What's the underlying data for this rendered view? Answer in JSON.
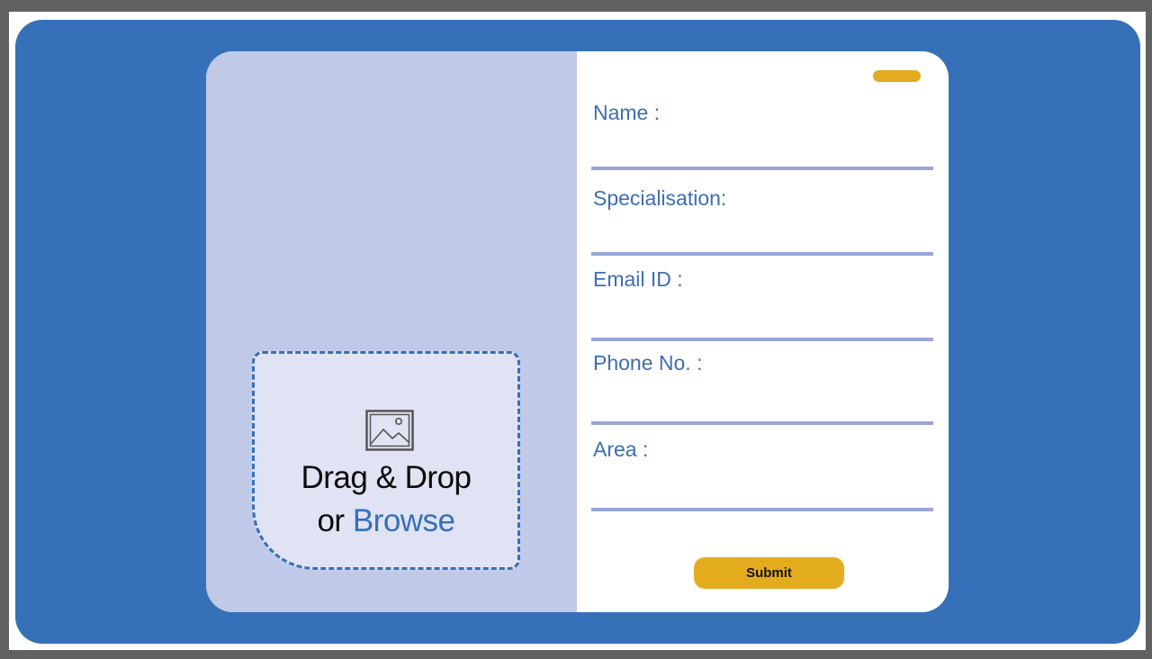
{
  "upload": {
    "icon": "image-icon",
    "line1": "Drag & Drop",
    "line2_prefix": "or ",
    "browse_label": "Browse"
  },
  "form": {
    "fields": [
      {
        "label": "Name :",
        "value": ""
      },
      {
        "label": "Specialisation:",
        "value": ""
      },
      {
        "label": "Email ID :",
        "value": ""
      },
      {
        "label": "Phone No. :",
        "value": ""
      },
      {
        "label": "Area :",
        "value": ""
      }
    ],
    "submit_label": "Submit"
  },
  "colors": {
    "background": "#3670b8",
    "left_panel": "#c0cae8",
    "dropzone": "#e0e3f4",
    "accent": "#e3ab1e",
    "label_text": "#3e6eb0",
    "underline": "#98a6d8"
  }
}
